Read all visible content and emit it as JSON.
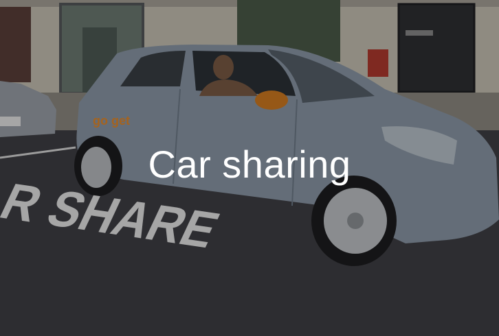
{
  "caption": {
    "text": "Car sharing"
  },
  "scene": {
    "car_branding": "go get",
    "road_marking": "CAR SHARE",
    "colors": {
      "car_body": "#8a97a6",
      "road": "#3e3e42",
      "building": "#c9c3b6",
      "road_paint": "#e8e8e8",
      "brand_orange": "#e58a2a",
      "caption_text": "#ffffff"
    }
  }
}
